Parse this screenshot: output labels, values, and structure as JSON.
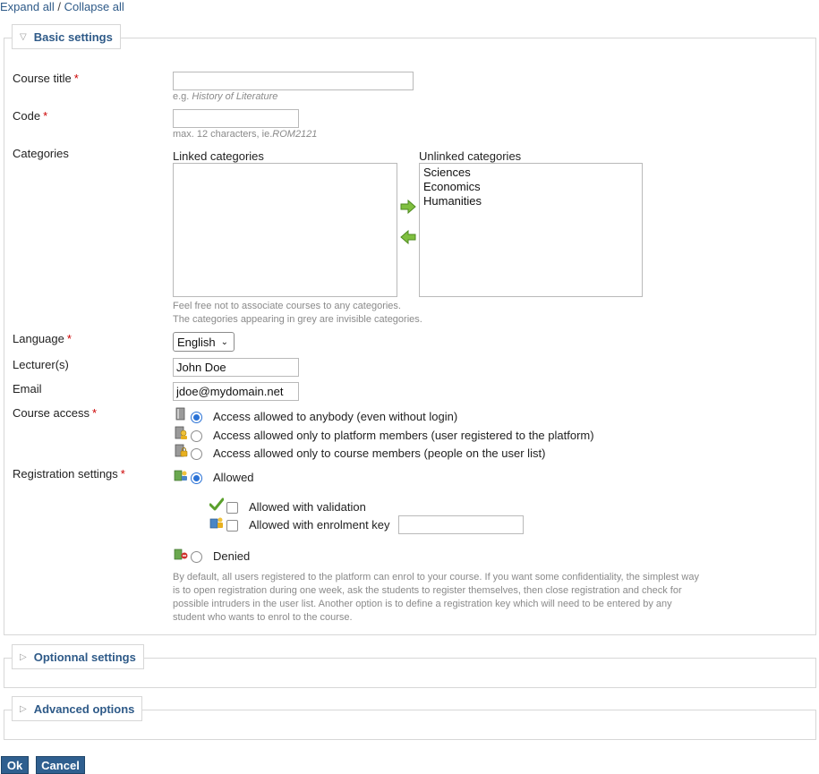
{
  "top_links": {
    "expand_all": "Expand all",
    "separator": "/",
    "collapse_all": "Collapse all"
  },
  "sections": {
    "basic": "Basic settings",
    "optional": "Optionnal settings",
    "advanced": "Advanced options"
  },
  "form": {
    "course_title": {
      "label": "Course title",
      "required": "*",
      "value": "",
      "hint_prefix": "e.g. ",
      "hint_example": "History of Literature"
    },
    "code": {
      "label": "Code",
      "required": "*",
      "value": "",
      "hint_prefix": "max. 12 characters, ie.",
      "hint_example": "ROM2121"
    },
    "categories": {
      "label": "Categories",
      "linked_title": "Linked categories",
      "unlinked_title": "Unlinked categories",
      "linked": [],
      "unlinked": [
        "Sciences",
        "Economics",
        "Humanities"
      ],
      "hint_line1": "Feel free not to associate courses to any categories.",
      "hint_line2": "The categories appearing in grey are invisible categories."
    },
    "language": {
      "label": "Language",
      "required": "*",
      "selected": "English"
    },
    "lecturers": {
      "label": "Lecturer(s)",
      "value": "John Doe"
    },
    "email": {
      "label": "Email",
      "value": "jdoe@mydomain.net"
    },
    "course_access": {
      "label": "Course access",
      "required": "*",
      "options": [
        "Access allowed to anybody (even without login)",
        "Access allowed only to platform members (user registered to the platform)",
        "Access allowed only to course members (people on the user list)"
      ],
      "selected_index": 0
    },
    "registration": {
      "label": "Registration settings",
      "required": "*",
      "allowed": "Allowed",
      "with_validation": "Allowed with validation",
      "with_key": "Allowed with enrolment key",
      "key_value": "",
      "denied": "Denied",
      "selected": "Allowed",
      "help_lines": [
        "By default, all users registered to the platform can enrol to your course. If you want some confidentiality, the simplest way",
        "is to open registration during one week, ask the students to register themselves, then close registration and check for",
        "possible intruders in the user list. Another option is to define a registration key which will need to be entered by any",
        "student who wants to enrol to the course."
      ]
    }
  },
  "buttons": {
    "ok": "Ok",
    "cancel": "Cancel"
  },
  "icons": {
    "add_arrow": "arrow-right-icon",
    "remove_arrow": "arrow-left-icon",
    "open_access": "book-icon",
    "platform_access": "user-book-icon",
    "members_access": "lock-book-icon",
    "allowed": "register-allowed-icon",
    "validation": "checkmark-icon",
    "key": "key-users-icon",
    "denied": "register-denied-icon"
  },
  "colors": {
    "link": "#2e5a88",
    "button": "#2f5f8f",
    "required": "#cc0000",
    "hint": "#8a8a8a",
    "radio": "#2a72d6"
  }
}
